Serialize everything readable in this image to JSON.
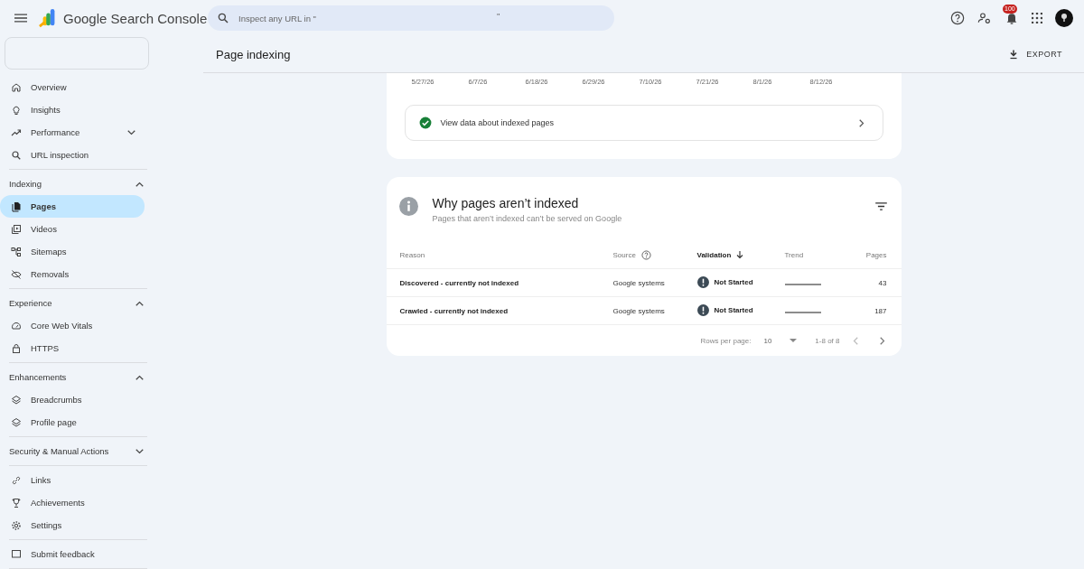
{
  "app": {
    "title": "Google Search Console"
  },
  "search": {
    "placeholder": "Inspect any URL in \"",
    "suffix": "\""
  },
  "notifications": {
    "count": "100"
  },
  "sidebar": {
    "groups": [
      {
        "items": [
          {
            "label": "Overview",
            "selected": false
          },
          {
            "label": "Insights",
            "selected": false
          },
          {
            "label": "Performance",
            "selected": false,
            "expanded": false
          },
          {
            "label": "URL inspection",
            "selected": false
          }
        ]
      },
      {
        "title": "Indexing",
        "expanded": true,
        "items": [
          {
            "label": "Pages",
            "selected": true
          },
          {
            "label": "Videos",
            "selected": false
          },
          {
            "label": "Sitemaps",
            "selected": false
          },
          {
            "label": "Removals",
            "selected": false
          }
        ]
      },
      {
        "title": "Experience",
        "expanded": true,
        "items": [
          {
            "label": "Core Web Vitals",
            "selected": false
          },
          {
            "label": "HTTPS",
            "selected": false
          }
        ]
      },
      {
        "title": "Enhancements",
        "expanded": true,
        "items": [
          {
            "label": "Breadcrumbs",
            "selected": false
          },
          {
            "label": "Profile page",
            "selected": false
          }
        ]
      },
      {
        "title": "Security & Manual Actions",
        "expanded": false
      },
      {
        "items": [
          {
            "label": "Links",
            "selected": false
          },
          {
            "label": "Achievements",
            "selected": false
          },
          {
            "label": "Settings",
            "selected": false
          }
        ]
      },
      {
        "items": [
          {
            "label": "Submit feedback",
            "selected": false
          }
        ]
      }
    ]
  },
  "page": {
    "title": "Page indexing",
    "export_label": "EXPORT"
  },
  "chart_axis": {
    "labels": [
      "5/27/26",
      "6/7/26",
      "6/18/26",
      "6/29/26",
      "7/10/26",
      "7/21/26",
      "8/1/26",
      "8/12/26"
    ]
  },
  "indexed_link": {
    "label": "View data about indexed pages"
  },
  "not_indexed": {
    "title": "Why pages aren’t indexed",
    "subtitle": "Pages that aren’t indexed can’t be served on Google",
    "columns": [
      "Reason",
      "Source",
      "Validation",
      "Trend",
      "Pages"
    ],
    "rows": [
      {
        "reason": "Discovered - currently not indexed",
        "source": "Google systems",
        "validation": "Not Started",
        "pages": "43"
      },
      {
        "reason": "Crawled - currently not indexed",
        "source": "Google systems",
        "validation": "Not Started",
        "pages": "187"
      }
    ],
    "pagination": {
      "rows_per_page_label": "Rows per page:",
      "rows_per_page": "10",
      "range": "1-8 of 8",
      "prev_disabled": true,
      "next_disabled": false
    }
  }
}
